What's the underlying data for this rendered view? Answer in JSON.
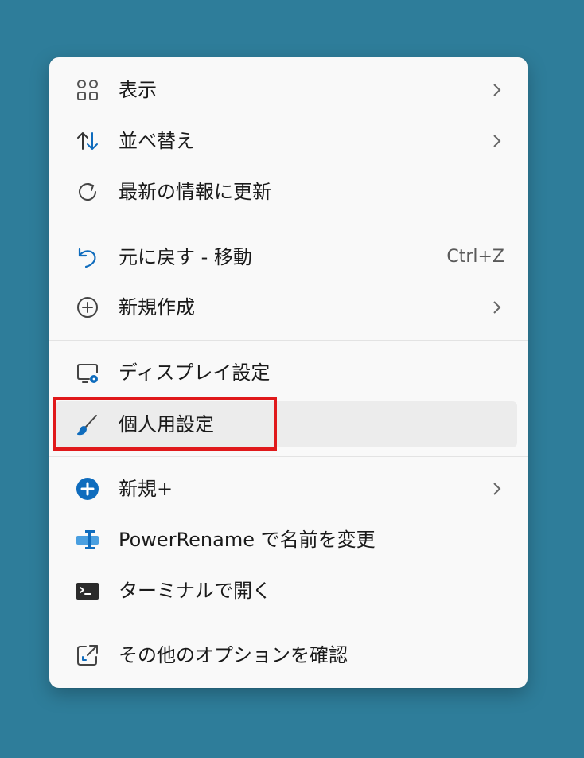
{
  "menu": {
    "items": [
      {
        "label": "表示",
        "icon": "view-grid-icon",
        "has_submenu": true
      },
      {
        "label": "並べ替え",
        "icon": "sort-arrows-icon",
        "has_submenu": true
      },
      {
        "label": "最新の情報に更新",
        "icon": "refresh-icon",
        "has_submenu": false
      },
      {
        "label": "元に戻す - 移動",
        "icon": "undo-icon",
        "shortcut": "Ctrl+Z"
      },
      {
        "label": "新規作成",
        "icon": "new-plus-circle-icon",
        "has_submenu": true
      },
      {
        "label": "ディスプレイ設定",
        "icon": "display-settings-icon",
        "has_submenu": false
      },
      {
        "label": "個人用設定",
        "icon": "brush-icon",
        "has_submenu": false,
        "highlighted": true
      },
      {
        "label": "新規+",
        "icon": "new-plus-filled-icon",
        "has_submenu": true
      },
      {
        "label": "PowerRename で名前を変更",
        "icon": "powerrename-icon",
        "has_submenu": false
      },
      {
        "label": "ターミナルで開く",
        "icon": "terminal-icon",
        "has_submenu": false
      },
      {
        "label": "その他のオプションを確認",
        "icon": "open-external-icon",
        "has_submenu": false
      }
    ]
  },
  "colors": {
    "background": "#2e7d9a",
    "menu_bg": "#f9f9f9",
    "accent": "#0f6cbd",
    "highlight_border": "#e0191b"
  }
}
